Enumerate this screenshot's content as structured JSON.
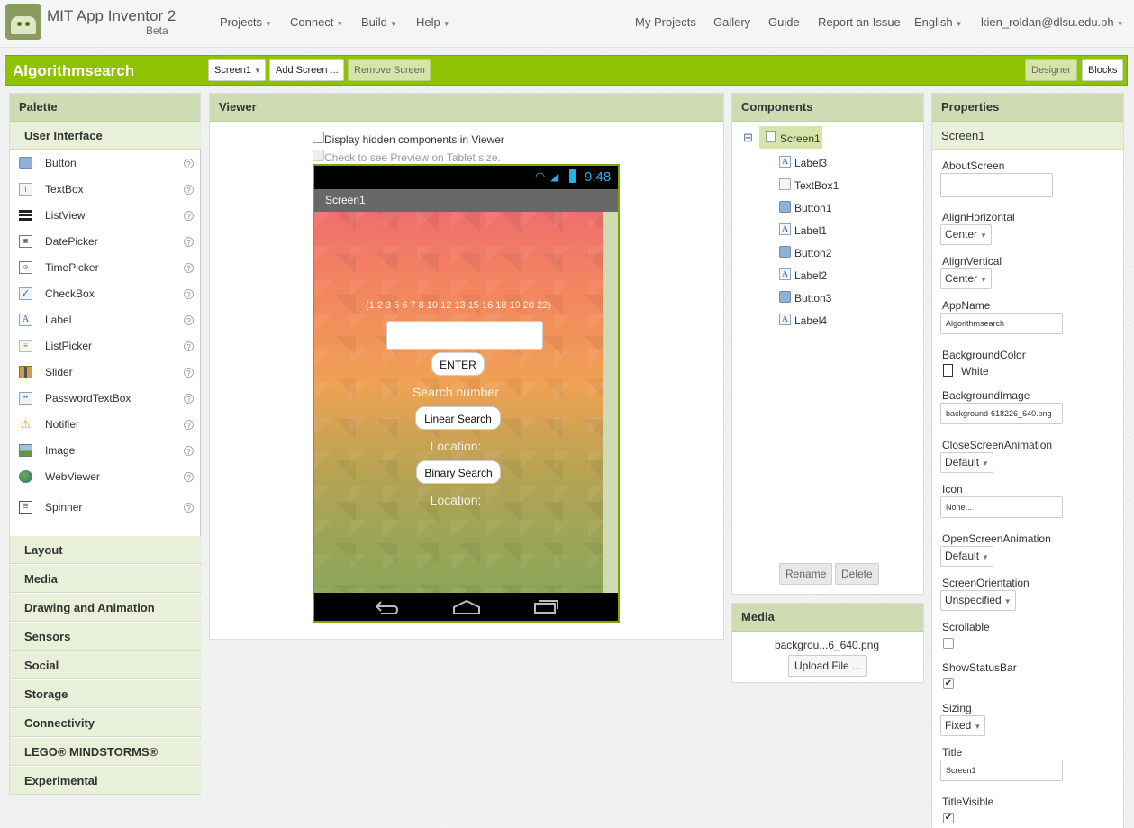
{
  "topbar": {
    "app_title": "MIT App Inventor 2",
    "app_subtitle": "Beta",
    "menus": [
      "Projects",
      "Connect",
      "Build",
      "Help"
    ],
    "links": [
      "My Projects",
      "Gallery",
      "Guide",
      "Report an Issue",
      "English"
    ],
    "user": "kien_roldan@dlsu.edu.ph"
  },
  "toolbar": {
    "project_name": "Algorithmsearch",
    "screen_select": "Screen1",
    "add_screen": "Add Screen ...",
    "remove_screen": "Remove Screen",
    "designer": "Designer",
    "blocks": "Blocks"
  },
  "palette": {
    "title": "Palette",
    "open_group": "User Interface",
    "items": [
      {
        "label": "Button",
        "icon": "button-icon"
      },
      {
        "label": "TextBox",
        "icon": "textbox-icon"
      },
      {
        "label": "ListView",
        "icon": "listview-icon"
      },
      {
        "label": "DatePicker",
        "icon": "datepicker-icon"
      },
      {
        "label": "TimePicker",
        "icon": "timepicker-icon"
      },
      {
        "label": "CheckBox",
        "icon": "checkbox-icon"
      },
      {
        "label": "Label",
        "icon": "label-icon"
      },
      {
        "label": "ListPicker",
        "icon": "listpicker-icon"
      },
      {
        "label": "Slider",
        "icon": "slider-icon"
      },
      {
        "label": "PasswordTextBox",
        "icon": "password-icon"
      },
      {
        "label": "Notifier",
        "icon": "notifier-icon"
      },
      {
        "label": "Image",
        "icon": "image-icon"
      },
      {
        "label": "WebViewer",
        "icon": "webviewer-icon"
      },
      {
        "label": "Spinner",
        "icon": "spinner-icon"
      }
    ],
    "help_glyph": "?",
    "groups": [
      "Layout",
      "Media",
      "Drawing and Animation",
      "Sensors",
      "Social",
      "Storage",
      "Connectivity",
      "LEGO® MINDSTORMS®",
      "Experimental"
    ]
  },
  "viewer": {
    "title": "Viewer",
    "hidden_checkbox": "Display hidden components in Viewer",
    "tablet_checkbox": "Check to see Preview on Tablet size.",
    "clock": "9:48",
    "screen_title": "Screen1",
    "sequence": "(1 2 3 5 6 7 8 10 12 13 15 16 18 19 20 22)",
    "enter": "ENTER",
    "search_number": "Search number",
    "linear": "Linear Search",
    "location1": "Location:",
    "binary": "Binary Search",
    "location2": "Location:"
  },
  "components": {
    "title": "Components",
    "collapse_glyph": "⊟",
    "root": "Screen1",
    "children": [
      {
        "name": "Label3",
        "kind": "lab"
      },
      {
        "name": "TextBox1",
        "kind": "txt"
      },
      {
        "name": "Button1",
        "kind": "btn"
      },
      {
        "name": "Label1",
        "kind": "lab"
      },
      {
        "name": "Button2",
        "kind": "btn"
      },
      {
        "name": "Label2",
        "kind": "lab"
      },
      {
        "name": "Button3",
        "kind": "btn"
      },
      {
        "name": "Label4",
        "kind": "lab"
      }
    ],
    "rename": "Rename",
    "delete": "Delete"
  },
  "media": {
    "title": "Media",
    "file": "backgrou...6_640.png",
    "upload": "Upload File ..."
  },
  "properties": {
    "title": "Properties",
    "component": "Screen1",
    "about_label": "AboutScreen",
    "align_h_label": "AlignHorizontal",
    "align_h": "Center",
    "align_v_label": "AlignVertical",
    "align_v": "Center",
    "appname_label": "AppName",
    "appname": "Algorithmsearch",
    "bgcolor_label": "BackgroundColor",
    "bgcolor": "White",
    "bgimage_label": "BackgroundImage",
    "bgimage": "background-618226_640.png",
    "close_anim_label": "CloseScreenAnimation",
    "close_anim": "Default",
    "icon_label": "Icon",
    "icon": "None...",
    "open_anim_label": "OpenScreenAnimation",
    "open_anim": "Default",
    "orientation_label": "ScreenOrientation",
    "orientation": "Unspecified",
    "scrollable_label": "Scrollable",
    "statusbar_label": "ShowStatusBar",
    "sizing_label": "Sizing",
    "sizing": "Fixed",
    "title_label": "Title",
    "title_value": "Screen1",
    "titlevisible_label": "TitleVisible",
    "check_mark": "✔"
  },
  "colors": {
    "accent_green": "#8fc202",
    "header_green": "#cfdcb3"
  }
}
